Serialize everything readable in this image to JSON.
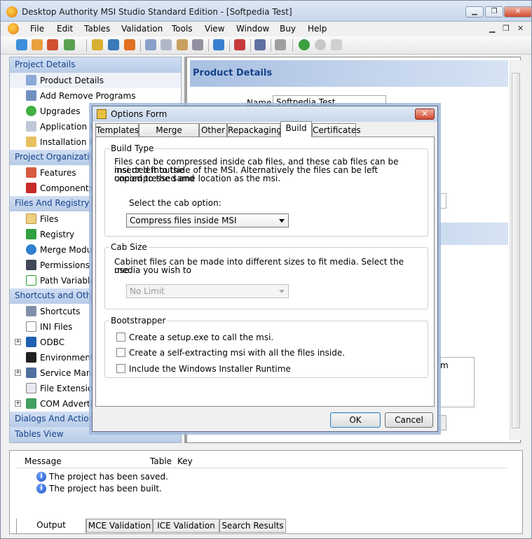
{
  "window": {
    "title": "Desktop Authority MSI Studio Standard Edition - [Softpedia Test]"
  },
  "menu": {
    "items": [
      "File",
      "Edit",
      "Tables",
      "Validation",
      "Tools",
      "View",
      "Window",
      "Buy",
      "Help"
    ]
  },
  "nav": {
    "sections": [
      {
        "title": "Project Details",
        "items": [
          {
            "label": "Product Details",
            "icon": "product-details-icon"
          },
          {
            "label": "Add Remove Programs",
            "icon": "add-remove-programs-icon"
          },
          {
            "label": "Upgrades",
            "icon": "upgrades-icon"
          },
          {
            "label": "Application Requ",
            "icon": "application-requirements-icon"
          },
          {
            "label": "Installation Prope",
            "icon": "installation-properties-icon"
          }
        ]
      },
      {
        "title": "Project Organization",
        "items": [
          {
            "label": "Features",
            "icon": "features-icon"
          },
          {
            "label": "Components",
            "icon": "components-icon"
          }
        ]
      },
      {
        "title": "Files And Registry",
        "items": [
          {
            "label": "Files",
            "icon": "folder-icon"
          },
          {
            "label": "Registry",
            "icon": "registry-icon"
          },
          {
            "label": "Merge Modules",
            "icon": "merge-modules-icon"
          },
          {
            "label": "Permissions",
            "icon": "permissions-icon"
          },
          {
            "label": "Path Variables",
            "icon": "path-variables-icon"
          }
        ]
      },
      {
        "title": "Shortcuts and Other Iten",
        "items": [
          {
            "label": "Shortcuts",
            "icon": "shortcuts-icon"
          },
          {
            "label": "INI Files",
            "icon": "ini-files-icon"
          },
          {
            "label": "ODBC",
            "icon": "odbc-icon"
          },
          {
            "label": "Environment Var",
            "icon": "environment-variables-icon"
          },
          {
            "label": "Service Manage",
            "icon": "service-manager-icon"
          },
          {
            "label": "File Extensions",
            "icon": "file-extensions-icon"
          },
          {
            "label": "COM Advertising",
            "icon": "com-advertising-icon"
          }
        ]
      },
      {
        "title": "Dialogs And Actions",
        "items": []
      },
      {
        "title": "Tables View",
        "items": []
      }
    ]
  },
  "content": {
    "title": "Product Details",
    "name_label": "Name:",
    "name_value": "Softpedia Test",
    "partial_text": "m"
  },
  "dialog": {
    "title": "Options Form",
    "close": "✕",
    "tabs": [
      "Templates",
      "Merge Modules",
      "Other",
      "Repackaging",
      "Build",
      "Certificates"
    ],
    "active_tab": "Build",
    "build_type": {
      "legend": "Build Type",
      "lines": [
        "Files can be compressed inside cab files, and these cab files can be inserted into the",
        "msi or left outside of the MSI. Alternatively the files can be left uncompressed and",
        "copied to the same location as the msi."
      ],
      "select_label": "Select the cab option:",
      "select_value": "Compress files inside MSI"
    },
    "cab_size": {
      "legend": "Cab Size",
      "lines": [
        "Cabinet files can be made into different sizes to fit media. Select the media you wish to",
        "use."
      ],
      "select_value": "No Limit"
    },
    "bootstrapper": {
      "legend": "Bootstrapper",
      "options": [
        "Create a setup.exe to call the msi.",
        "Create a self-extracting msi with all the files inside.",
        "Include the Windows Installer Runtime"
      ]
    },
    "ok": "OK",
    "cancel": "Cancel"
  },
  "messages": {
    "close": "✕",
    "columns": [
      "Message",
      "Table",
      "Key"
    ],
    "rows": [
      "The project has been saved.",
      "The project has been built."
    ],
    "tabs": [
      "Output",
      "MCE Validation",
      "ICE Validation",
      "Search Results"
    ],
    "active_tab": "Output"
  }
}
